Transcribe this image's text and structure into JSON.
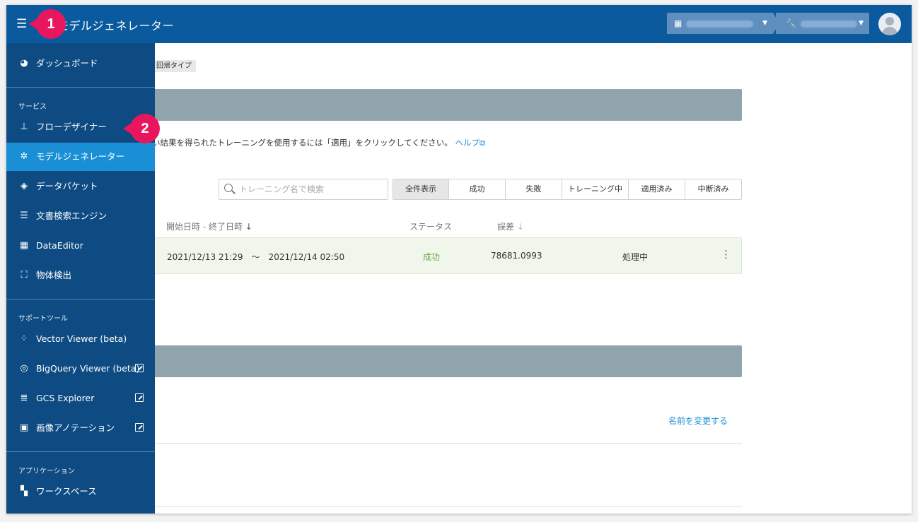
{
  "header": {
    "title": "モデルジェネレーター",
    "org_selector_value": "",
    "project_selector_value": ""
  },
  "main": {
    "tag": "回帰タイプ",
    "info_text": "い結果を得られたトレーニングを使用するには「適用」をクリックしてください。",
    "help_link": "ヘルプ",
    "search_placeholder": "トレーニング名で検索",
    "filters": [
      "全件表示",
      "成功",
      "失敗",
      "トレーニング中",
      "適用済み",
      "中断済み"
    ],
    "columns": {
      "datetime": "開始日時 - 終了日時",
      "status": "ステータス",
      "error": "誤差"
    },
    "rows": [
      {
        "datetime": "2021/12/13 21:29　〜　2021/12/14 02:50",
        "status": "成功",
        "error": "78681.0993",
        "state": "処理中"
      }
    ],
    "rename_link": "名前を変更する"
  },
  "sidebar": {
    "dashboard": "ダッシュボード",
    "section_services": "サービス",
    "services": [
      "フローデザイナー",
      "モデルジェネレーター",
      "データバケット",
      "文書検索エンジン",
      "DataEditor",
      "物体検出"
    ],
    "section_tools": "サポートツール",
    "tools": [
      "Vector Viewer (beta)",
      "BigQuery Viewer (beta)",
      "GCS Explorer",
      "画像アノテーション"
    ],
    "section_apps": "アプリケーション",
    "apps": [
      "ワークスペース"
    ]
  },
  "callouts": [
    "1",
    "2"
  ]
}
